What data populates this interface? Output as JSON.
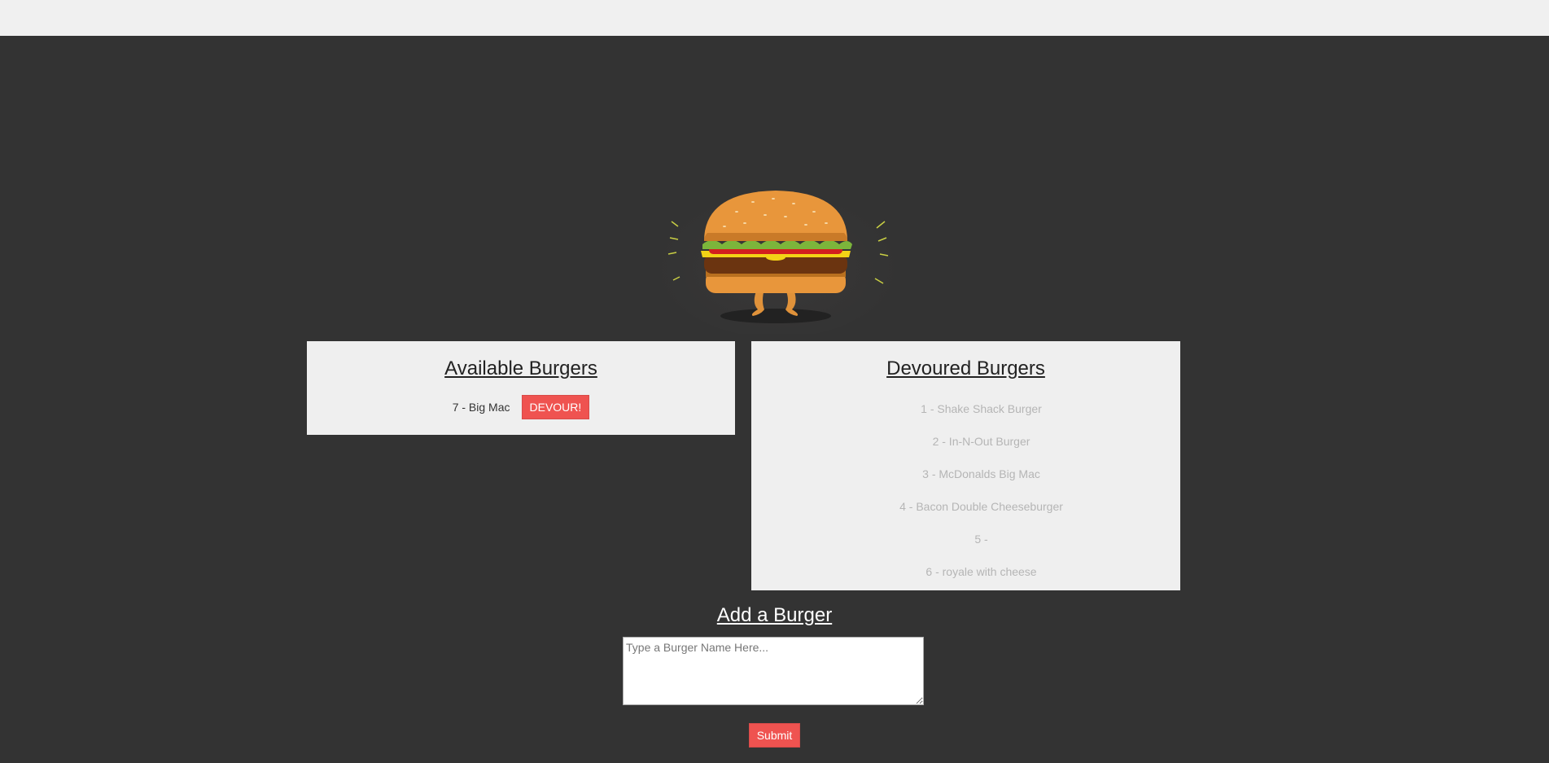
{
  "available": {
    "title": "Available Burgers",
    "items": [
      {
        "label": "7 - Big Mac",
        "button": "DEVOUR!"
      }
    ]
  },
  "devoured": {
    "title": "Devoured Burgers",
    "items": [
      "1 - Shake Shack Burger",
      "2 - In-N-Out Burger",
      "3 - McDonalds Big Mac",
      "4 - Bacon Double Cheeseburger",
      "5 -",
      "6 - royale with cheese"
    ]
  },
  "add_form": {
    "title": "Add a Burger",
    "placeholder": "Type a Burger Name Here...",
    "value": "",
    "submit_label": "Submit"
  },
  "colors": {
    "background": "#333333",
    "panel": "#efefef",
    "accent_button": "#ef5350"
  },
  "icons": {
    "hero": "burger-mascot-icon"
  }
}
